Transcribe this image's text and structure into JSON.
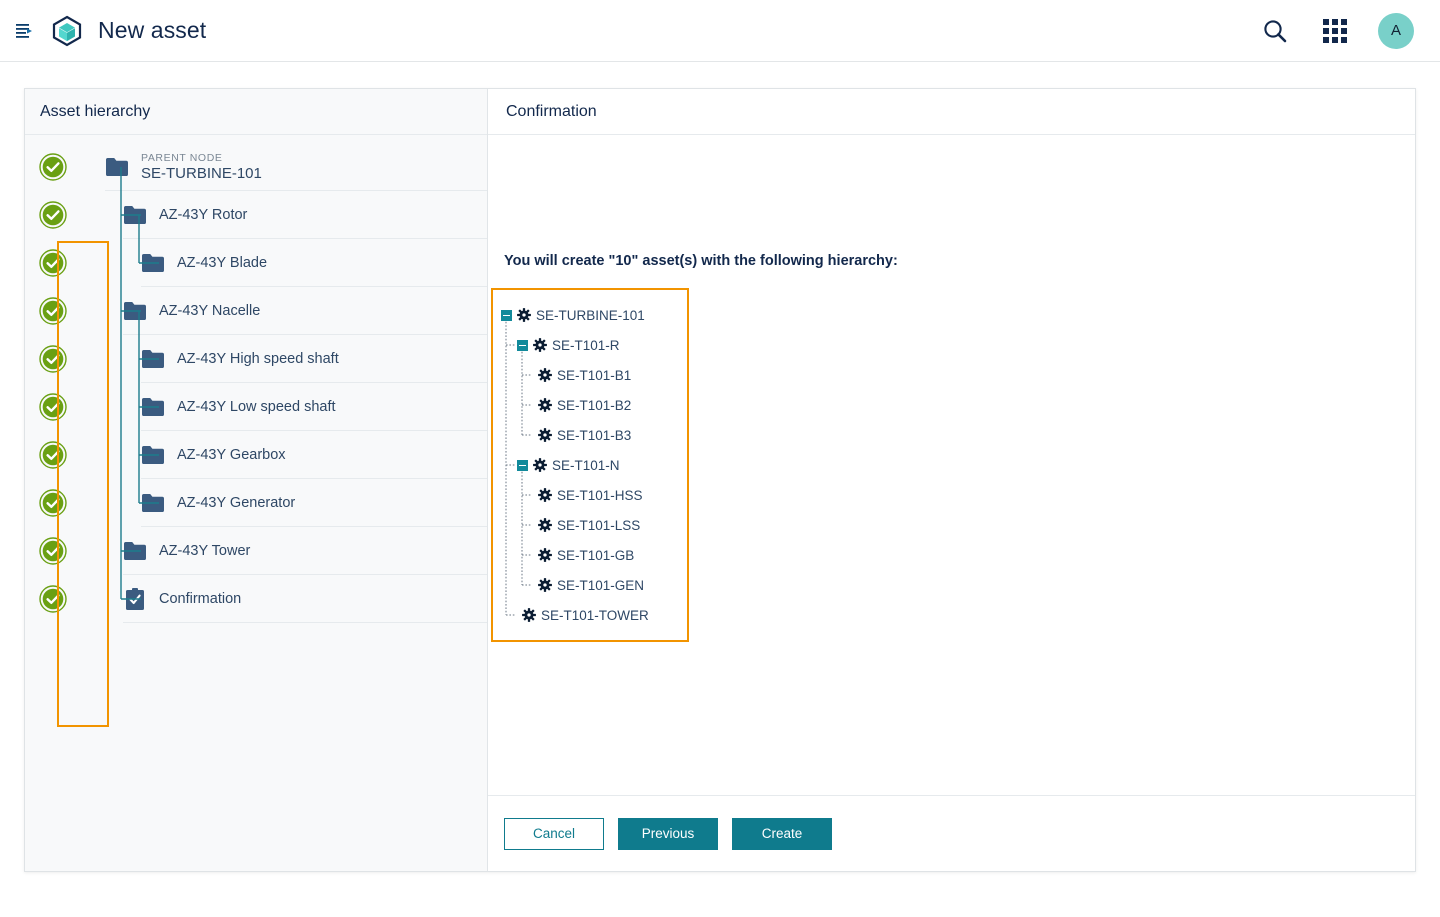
{
  "topbar": {
    "menu_icon": "list-menu-icon",
    "logo_icon": "cube-logo-icon",
    "title": "New asset",
    "search_icon": "search-icon",
    "apps_icon": "apps-grid-icon",
    "avatar_initial": "A"
  },
  "colors": {
    "accent_teal": "#0f7b8d",
    "highlight_orange": "#f29400",
    "check_green": "#6aa013",
    "folder_blue": "#3b5b80",
    "text_navy": "#12284c",
    "panel_bg": "#f8f9fa"
  },
  "left_panel": {
    "header": "Asset hierarchy",
    "rows": [
      {
        "kicker": "PARENT NODE",
        "label": "SE-TURBINE-101",
        "icon": "folder-icon",
        "depth": 0,
        "checked": true
      },
      {
        "kicker": "",
        "label": "AZ-43Y Rotor",
        "icon": "folder-icon",
        "depth": 1,
        "checked": true
      },
      {
        "kicker": "",
        "label": "AZ-43Y Blade",
        "icon": "folder-icon",
        "depth": 2,
        "checked": true
      },
      {
        "kicker": "",
        "label": "AZ-43Y Nacelle",
        "icon": "folder-icon",
        "depth": 1,
        "checked": true
      },
      {
        "kicker": "",
        "label": "AZ-43Y High speed shaft",
        "icon": "folder-icon",
        "depth": 2,
        "checked": true
      },
      {
        "kicker": "",
        "label": "AZ-43Y Low speed shaft",
        "icon": "folder-icon",
        "depth": 2,
        "checked": true
      },
      {
        "kicker": "",
        "label": "AZ-43Y Gearbox",
        "icon": "folder-icon",
        "depth": 2,
        "checked": true
      },
      {
        "kicker": "",
        "label": "AZ-43Y Generator",
        "icon": "folder-icon",
        "depth": 2,
        "checked": true
      },
      {
        "kicker": "",
        "label": "AZ-43Y Tower",
        "icon": "folder-icon",
        "depth": 1,
        "checked": true
      },
      {
        "kicker": "",
        "label": "Confirmation",
        "icon": "clipboard-check-icon",
        "depth": 1,
        "checked": true
      }
    ]
  },
  "right_panel": {
    "header": "Confirmation",
    "summary_text": "You will create \"10\" asset(s) with the following hierarchy:",
    "asset_count": "10",
    "tree": [
      {
        "label": "SE-TURBINE-101",
        "depth": 0,
        "expander": "minus",
        "icon": "gear-icon"
      },
      {
        "label": "SE-T101-R",
        "depth": 1,
        "expander": "minus",
        "icon": "gear-icon"
      },
      {
        "label": "SE-T101-B1",
        "depth": 2,
        "expander": "none",
        "icon": "gear-icon"
      },
      {
        "label": "SE-T101-B2",
        "depth": 2,
        "expander": "none",
        "icon": "gear-icon"
      },
      {
        "label": "SE-T101-B3",
        "depth": 2,
        "expander": "none",
        "icon": "gear-icon"
      },
      {
        "label": "SE-T101-N",
        "depth": 1,
        "expander": "minus",
        "icon": "gear-icon"
      },
      {
        "label": "SE-T101-HSS",
        "depth": 2,
        "expander": "none",
        "icon": "gear-icon"
      },
      {
        "label": "SE-T101-LSS",
        "depth": 2,
        "expander": "none",
        "icon": "gear-icon"
      },
      {
        "label": "SE-T101-GB",
        "depth": 2,
        "expander": "none",
        "icon": "gear-icon"
      },
      {
        "label": "SE-T101-GEN",
        "depth": 2,
        "expander": "none",
        "icon": "gear-icon"
      },
      {
        "label": "SE-T101-TOWER",
        "depth": 1,
        "expander": "none",
        "icon": "gear-icon"
      }
    ],
    "footer": {
      "cancel": "Cancel",
      "previous": "Previous",
      "create": "Create"
    }
  }
}
